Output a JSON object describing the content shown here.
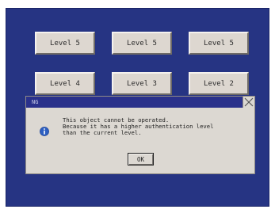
{
  "buttons": {
    "row1": [
      "Level 5",
      "Level 5",
      "Level 5"
    ],
    "row2": [
      "Level 4",
      "Level 3",
      "Level 2"
    ]
  },
  "dialog": {
    "title": "NG",
    "messages": [
      "This object cannot be operated.",
      "Because it has a higher authentication level",
      "than the current level."
    ],
    "ok_label": "OK"
  },
  "colors": {
    "screen_bg": "#263483",
    "button_face": "#ddd7d0",
    "dialog_face": "#dcd8d2",
    "titlebar": "#2a318b",
    "info_icon": "#2d5fc1"
  },
  "icons": {
    "dialog": "info-icon",
    "close": "close-icon"
  }
}
